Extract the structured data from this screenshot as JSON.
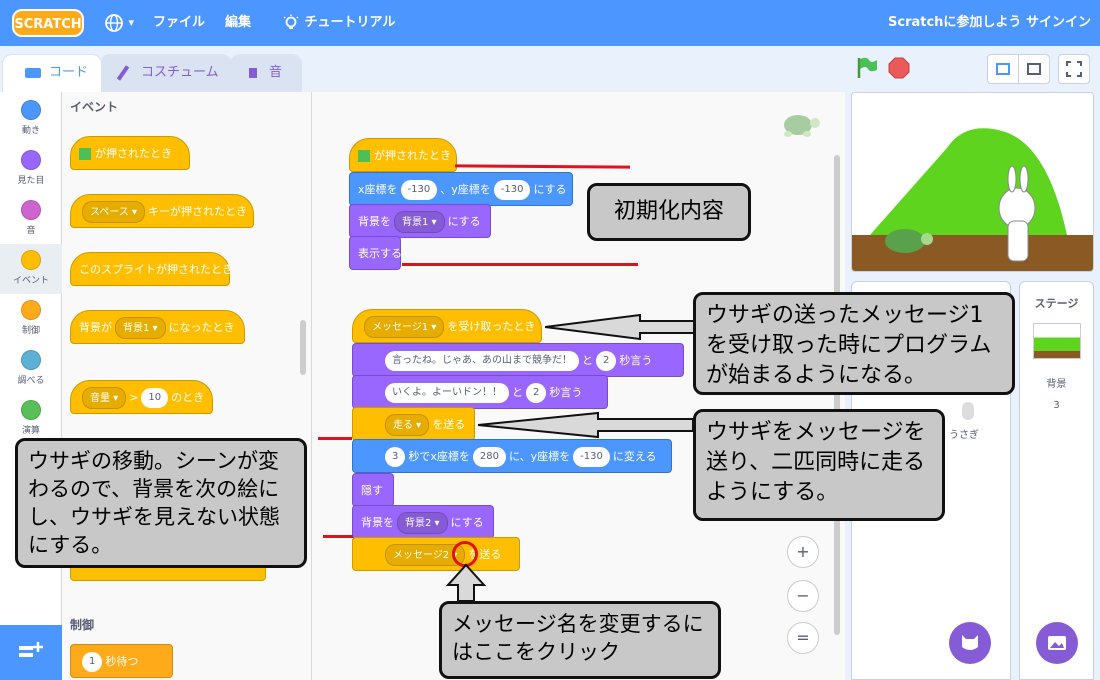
{
  "menubar": {
    "logo": "SCRATCH",
    "globe_caret": "▾",
    "file": "ファイル",
    "edit": "編集",
    "tutorial": "チュートリアル",
    "join": "Scratchに参加しよう",
    "signin": "サインイン"
  },
  "tabs": {
    "code": "コード",
    "costume": "コスチューム",
    "sound": "音"
  },
  "categories": [
    {
      "label": "動き",
      "color": "#4c97ff"
    },
    {
      "label": "見た目",
      "color": "#9966ff"
    },
    {
      "label": "音",
      "color": "#cf63cf"
    },
    {
      "label": "イベント",
      "color": "#ffbf00"
    },
    {
      "label": "制御",
      "color": "#ffab19"
    },
    {
      "label": "調べる",
      "color": "#5cb1d6"
    },
    {
      "label": "演算",
      "color": "#59c059"
    }
  ],
  "palette": {
    "events_title": "イベント",
    "flag_clicked": "が押されたとき",
    "key_default": "スペース ▾",
    "key_pressed": "キーが押されたとき",
    "sprite_clicked": "このスプライトが押されたとき",
    "backdrop_prefix": "背景が",
    "backdrop_value": "背景1 ▾",
    "backdrop_suffix": "になったとき",
    "loudness": "音量 ▾",
    "gt": ">",
    "gt_value": "10",
    "gt_suffix": "のとき",
    "control_title": "制御",
    "wait_value": "1",
    "wait_suffix": "秒待つ"
  },
  "script": {
    "flag_hat": "が押されたとき",
    "goto_x_label": "x座標を",
    "goto_x": "-130",
    "goto_y_label": "、y座標を",
    "goto_y": "-130",
    "goto_suffix": "にする",
    "switch_backdrop_label": "背景を",
    "switch_backdrop_1": "背景1 ▾",
    "switch_suffix": "にする",
    "show": "表示する",
    "receive_msg": "メッセージ1 ▾",
    "receive_suffix": "を受け取ったとき",
    "say1_text": "言ったね。じゃあ、あの山まで競争だ！",
    "say1_and": "と",
    "say1_secs": "2",
    "say1_suffix": "秒言う",
    "say2_text": "いくよ。よーいドン！！",
    "say2_and": "と",
    "say2_secs": "2",
    "say2_suffix": "秒言う",
    "broadcast_run": "走る ▾",
    "broadcast_suffix": "を送る",
    "glide_secs": "3",
    "glide_label": "秒でx座標を",
    "glide_x": "280",
    "glide_mid": "に、y座標を",
    "glide_y": "-130",
    "glide_suffix": "に変える",
    "hide": "隠す",
    "switch_backdrop_2": "背景2 ▾",
    "broadcast2_msg": "メッセージ2",
    "broadcast2_caret": "▾",
    "broadcast2_suffix": "を送る"
  },
  "sprites": {
    "rabbit_name": "うさぎ"
  },
  "stage_panel": {
    "title": "ステージ",
    "backdrop_label": "背景",
    "backdrop_count": "3"
  },
  "zoom": {
    "in": "+",
    "out": "−",
    "reset": "="
  },
  "callouts": {
    "init": "初期化内容",
    "receive": "ウサギの送ったメッセージ1を受け取った時にプログラムが始まるようになる。",
    "send": "ウサギをメッセージを送り、二匹同時に走るようにする。",
    "move": "ウサギの移動。シーンが変わるので、背景を次の絵にし、ウサギを見えない状態にする。",
    "click": "メッセージ名を変更するにはここをクリック"
  }
}
